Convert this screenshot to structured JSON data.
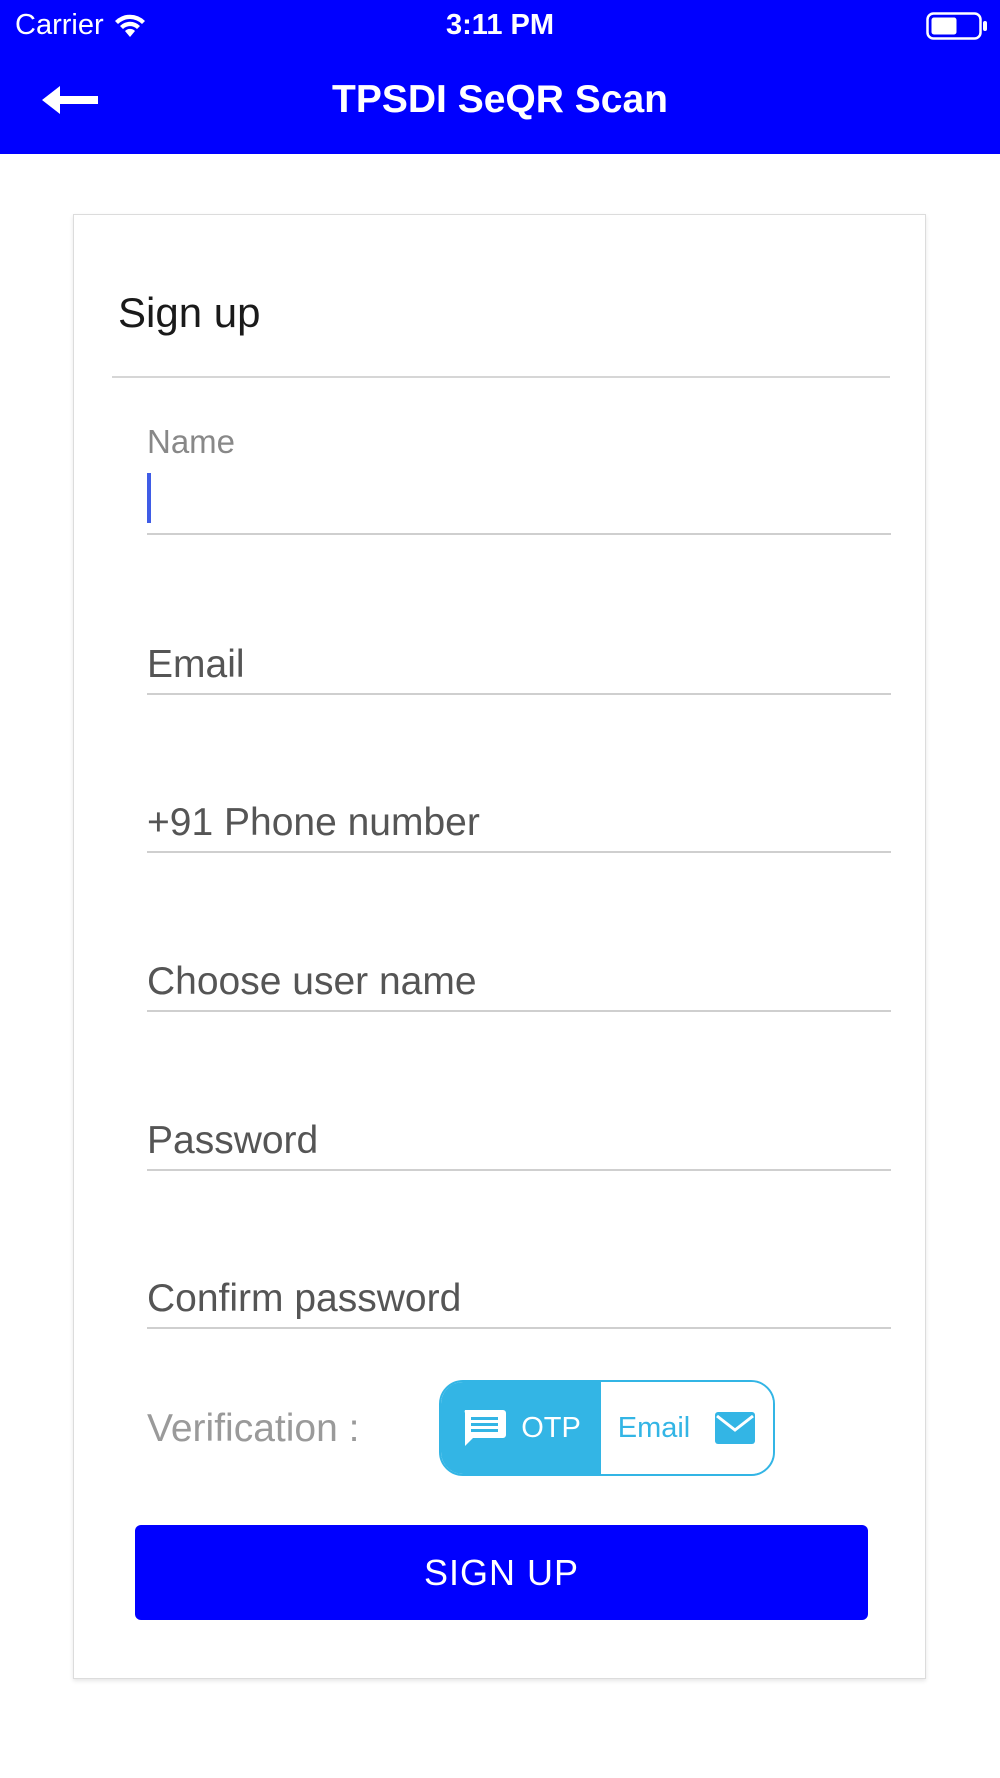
{
  "status_bar": {
    "carrier": "Carrier",
    "time": "3:11 PM"
  },
  "nav": {
    "title": "TPSDI SeQR Scan",
    "back_icon": "arrow-left-icon"
  },
  "form": {
    "title": "Sign up",
    "fields": {
      "name": {
        "label": "Name",
        "value": ""
      },
      "email": {
        "placeholder": "Email"
      },
      "phone": {
        "placeholder": "+91 Phone number"
      },
      "username": {
        "placeholder": "Choose user name"
      },
      "password": {
        "placeholder": "Password"
      },
      "confirm_password": {
        "placeholder": "Confirm password"
      }
    },
    "verification": {
      "label": "Verification :",
      "options": [
        {
          "label": "OTP",
          "icon": "chat-icon",
          "selected": true
        },
        {
          "label": "Email",
          "icon": "mail-icon",
          "selected": false
        }
      ]
    },
    "submit_label": "SIGN UP"
  },
  "colors": {
    "primary": "#0000ff",
    "toggle_accent": "#33b5e5",
    "caret": "#3f5ce6"
  }
}
